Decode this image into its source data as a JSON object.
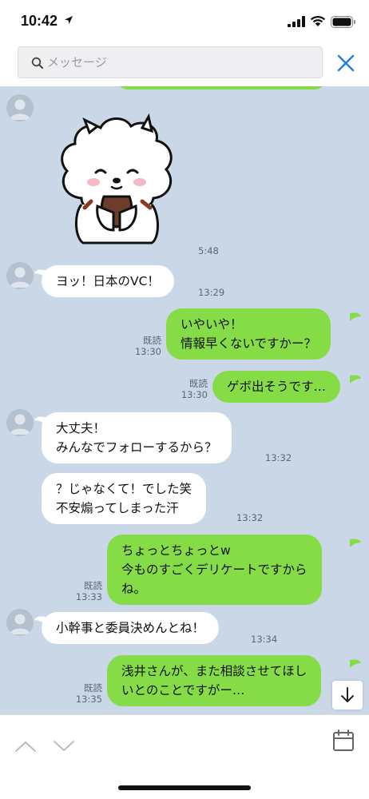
{
  "status_bar": {
    "time": "10:42"
  },
  "search": {
    "placeholder": "メッセージ",
    "value": ""
  },
  "messages": [
    {
      "id": "sticker",
      "time": "5:48"
    },
    {
      "id": "m1",
      "text_lines": [
        "ヨッ！日本のVC！"
      ],
      "time": "13:29"
    },
    {
      "id": "m2",
      "text_lines": [
        "いやいや！",
        "情報早くないですかー？"
      ],
      "read": "既読",
      "time": "13:30"
    },
    {
      "id": "m3",
      "text_lines": [
        "ゲボ出そうです…"
      ],
      "read": "既読",
      "time": "13:30"
    },
    {
      "id": "m4",
      "text_lines": [
        "大丈夫！",
        "みんなでフォローするから？"
      ],
      "time": "13:32"
    },
    {
      "id": "m5",
      "text_lines": [
        "？じゃなくて！でした笑",
        "不安煽ってしまった汗"
      ],
      "time": "13:32"
    },
    {
      "id": "m6",
      "text_lines": [
        "ちょっとちょっとw",
        "今ものすごくデリケートですから",
        "ね。"
      ],
      "read": "既読",
      "time": "13:33"
    },
    {
      "id": "m7",
      "text_lines": [
        "小幹事と委員決めんとね！"
      ],
      "time": "13:34"
    },
    {
      "id": "m8",
      "text_lines": [
        "浅井さんが、また相談させてほし",
        "いとのことですがー…"
      ],
      "read": "既読",
      "time": "13:35"
    }
  ],
  "colors": {
    "chat_background": "#c9d7e6",
    "outgoing_bubble": "#85dc47",
    "incoming_bubble": "#ffffff",
    "accent": "#1f7fe0"
  }
}
